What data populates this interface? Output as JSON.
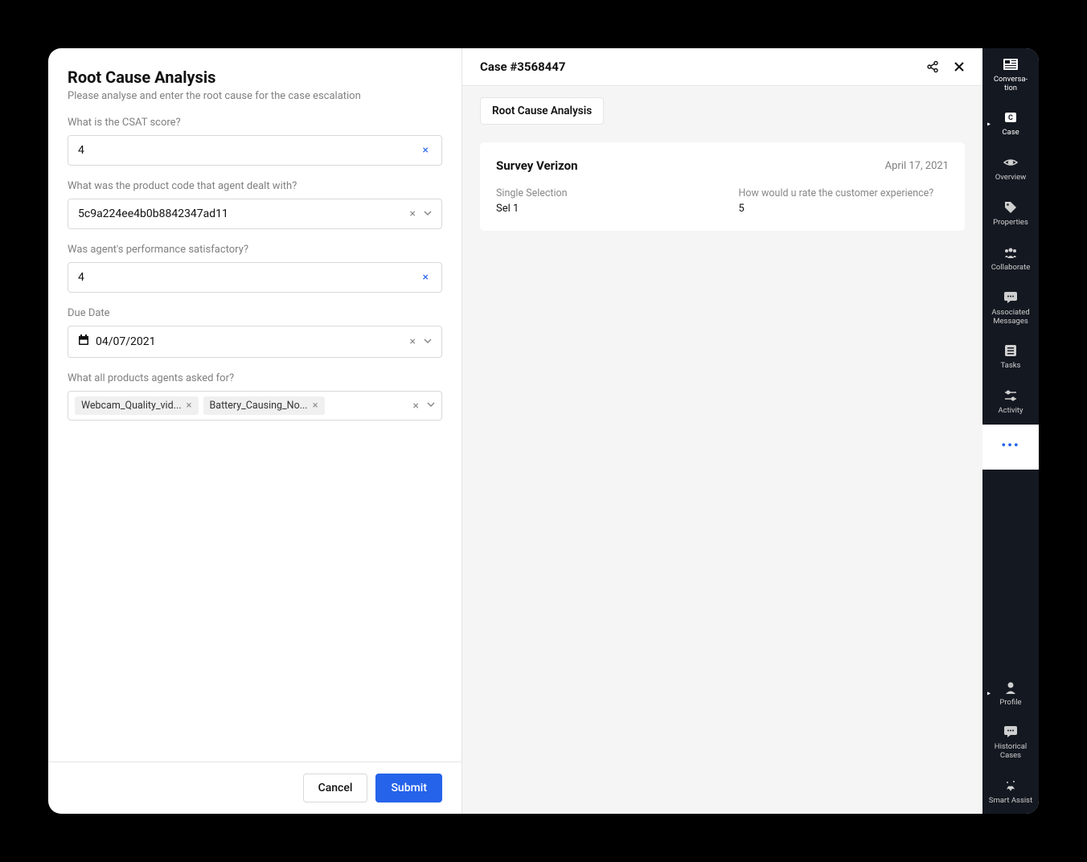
{
  "form": {
    "title": "Root Cause Analysis",
    "subtitle": "Please analyse and enter the root cause for the case escalation",
    "fields": {
      "csat": {
        "label": "What is the CSAT score?",
        "value": "4"
      },
      "product_code": {
        "label": "What was the product code that agent dealt with?",
        "value": "5c9a224ee4b0b8842347ad11"
      },
      "performance": {
        "label": "Was agent's performance satisfactory?",
        "value": "4"
      },
      "due_date": {
        "label": "Due Date",
        "value": "04/07/2021"
      },
      "products": {
        "label": "What all products agents asked for?",
        "tags": [
          "Webcam_Quality_vid...",
          "Battery_Causing_No..."
        ]
      }
    },
    "buttons": {
      "cancel": "Cancel",
      "submit": "Submit"
    }
  },
  "case": {
    "title": "Case #3568447",
    "tab": "Root Cause Analysis",
    "survey": {
      "title": "Survey Verizon",
      "date": "April 17, 2021",
      "q1_label": "Single Selection",
      "q1_value": "Sel 1",
      "q2_label": "How would u rate the customer experience?",
      "q2_value": "5"
    }
  },
  "rail": {
    "items_top": [
      {
        "id": "conversation",
        "label": "Conversa-\ntion"
      },
      {
        "id": "case",
        "label": "Case"
      },
      {
        "id": "overview",
        "label": "Overview"
      },
      {
        "id": "properties",
        "label": "Properties"
      },
      {
        "id": "collaborate",
        "label": "Collaborate"
      },
      {
        "id": "associated-messages",
        "label": "Associated\nMessages"
      },
      {
        "id": "tasks",
        "label": "Tasks"
      },
      {
        "id": "activity",
        "label": "Activity"
      }
    ],
    "items_bottom": [
      {
        "id": "profile",
        "label": "Profile"
      },
      {
        "id": "historical-cases",
        "label": "Historical\nCases"
      },
      {
        "id": "smart-assist",
        "label": "Smart Assist"
      }
    ]
  }
}
